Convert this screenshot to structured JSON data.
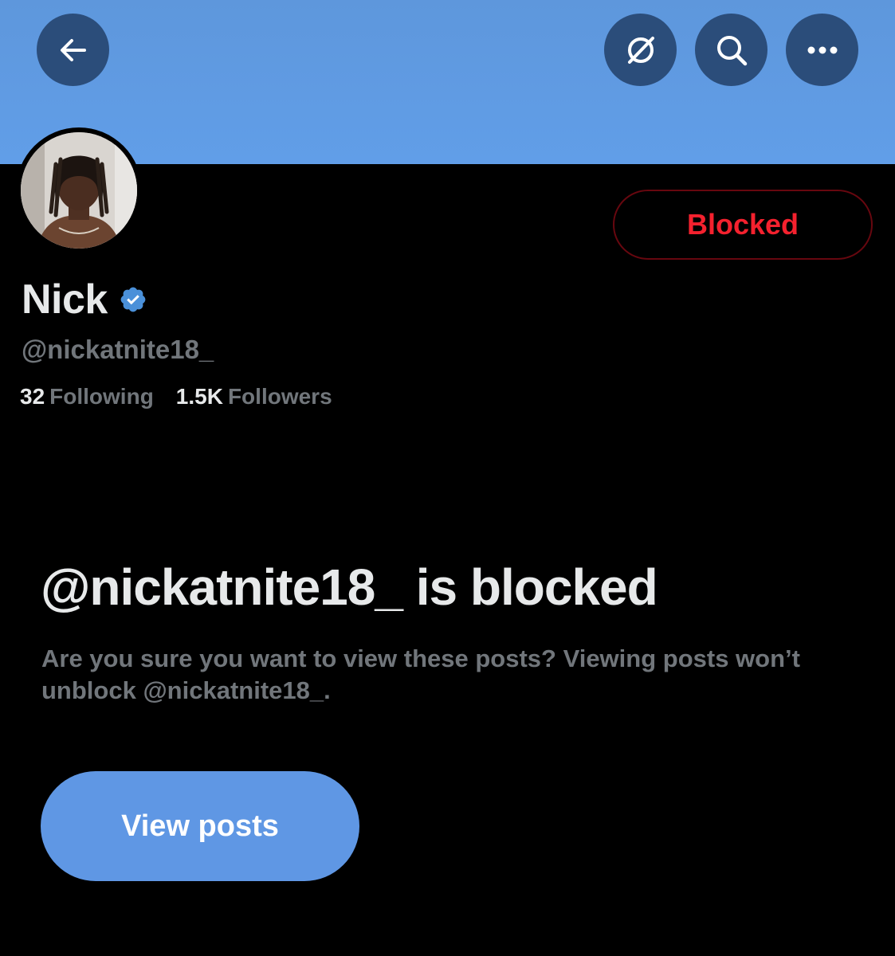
{
  "header": {
    "back_icon": "arrow-left-icon",
    "grok_icon": "grok-icon",
    "search_icon": "search-icon",
    "more_icon": "more-horizontal-icon",
    "banner_color": "#5e97dc"
  },
  "profile": {
    "avatar": "profile-photo",
    "name": "Nick",
    "verified": true,
    "verified_color": "#1d9bf0",
    "handle": "@nickatnite18_",
    "following_count": "32",
    "following_label": "Following",
    "followers_count": "1.5K",
    "followers_label": "Followers"
  },
  "blocked_button": {
    "label": "Blocked",
    "color": "#f4212e"
  },
  "blocked_notice": {
    "title": "@nickatnite18_ is blocked",
    "description": "Are you sure you want to view these posts? Viewing posts won’t unblock @nickatnite18_.",
    "view_button_label": "View posts",
    "view_button_color": "#5f97e4"
  }
}
